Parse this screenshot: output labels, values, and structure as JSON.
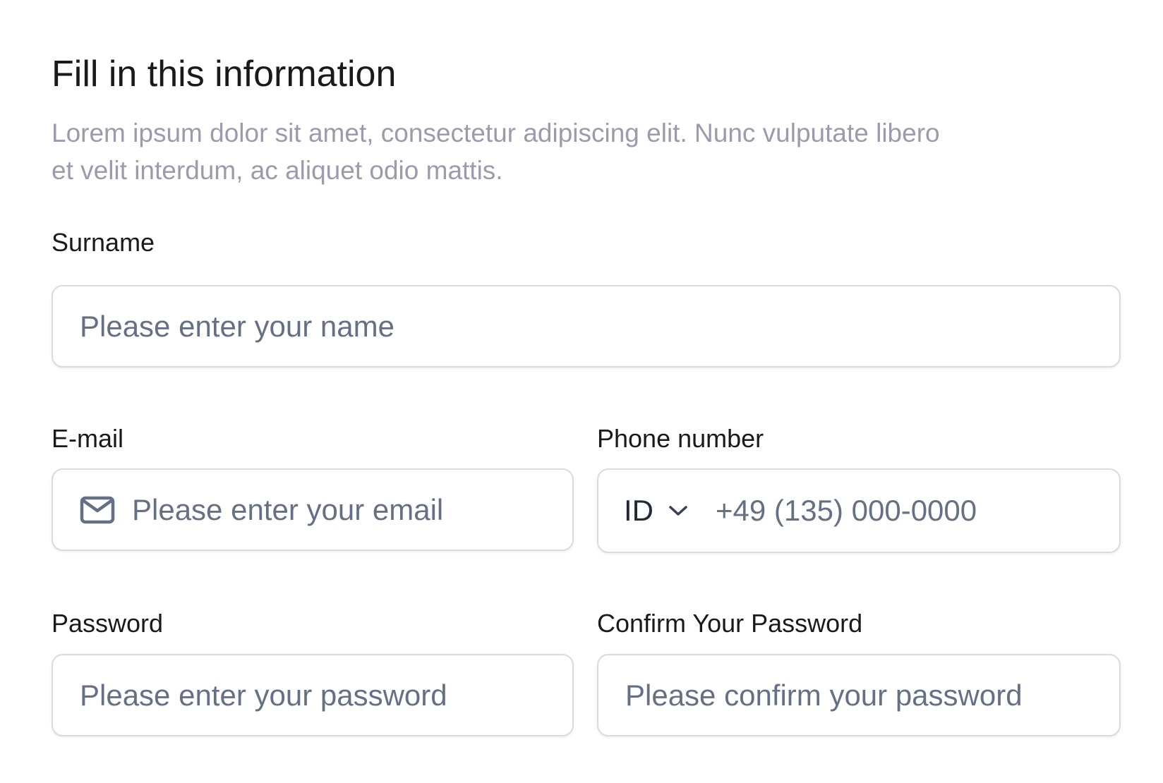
{
  "form": {
    "title": "Fill in this information",
    "description": "Lorem ipsum dolor sit amet, consectetur adipiscing elit. Nunc vulputate libero et velit interdum, ac aliquet odio mattis."
  },
  "fields": {
    "surname": {
      "label": "Surname",
      "placeholder": "Please enter your name"
    },
    "email": {
      "label": "E-mail",
      "placeholder": "Please enter your email",
      "icon": "mail-icon"
    },
    "phone": {
      "label": "Phone number",
      "country_code": "ID",
      "country_icon": "chevron-down-icon",
      "placeholder": "+49 (135) 000-0000"
    },
    "password": {
      "label": "Password",
      "placeholder": "Please enter your password"
    },
    "confirm_password": {
      "label": "Confirm Your Password",
      "placeholder": "Please confirm your password"
    }
  },
  "colors": {
    "title": "#1a1a1a",
    "description": "#9a9cae",
    "placeholder": "#667085",
    "border": "#d9dbe0",
    "icon": "#667085"
  }
}
